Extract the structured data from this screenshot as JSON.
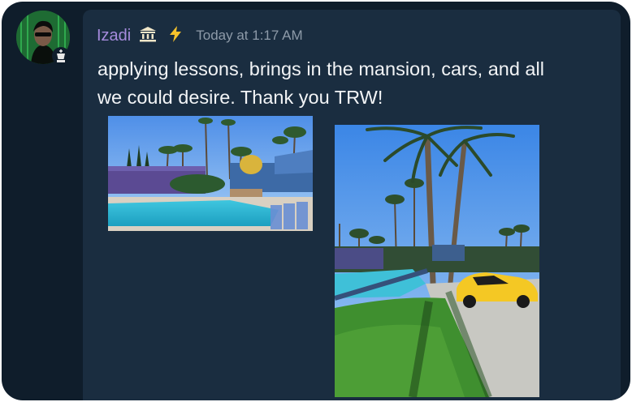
{
  "message": {
    "username": "Izadi",
    "username_color": "#a58bdc",
    "timestamp": "Today at 1:17 AM",
    "text_line1": "applying lessons, brings in the mansion, cars, and all",
    "text_line2": "we could desire. Thank you TRW!"
  },
  "badges": [
    "bank-icon",
    "lightning-icon"
  ],
  "attachments": [
    {
      "name": "pool-photo",
      "description": "resort pool with palm trees"
    },
    {
      "name": "yellow-car-photo",
      "description": "palm trees, lawn, pool and yellow sports car"
    }
  ],
  "colors": {
    "background": "#0f1d2b",
    "card": "#1a2d40",
    "text": "#f2f4f6",
    "timestamp": "#8d9aa8"
  }
}
